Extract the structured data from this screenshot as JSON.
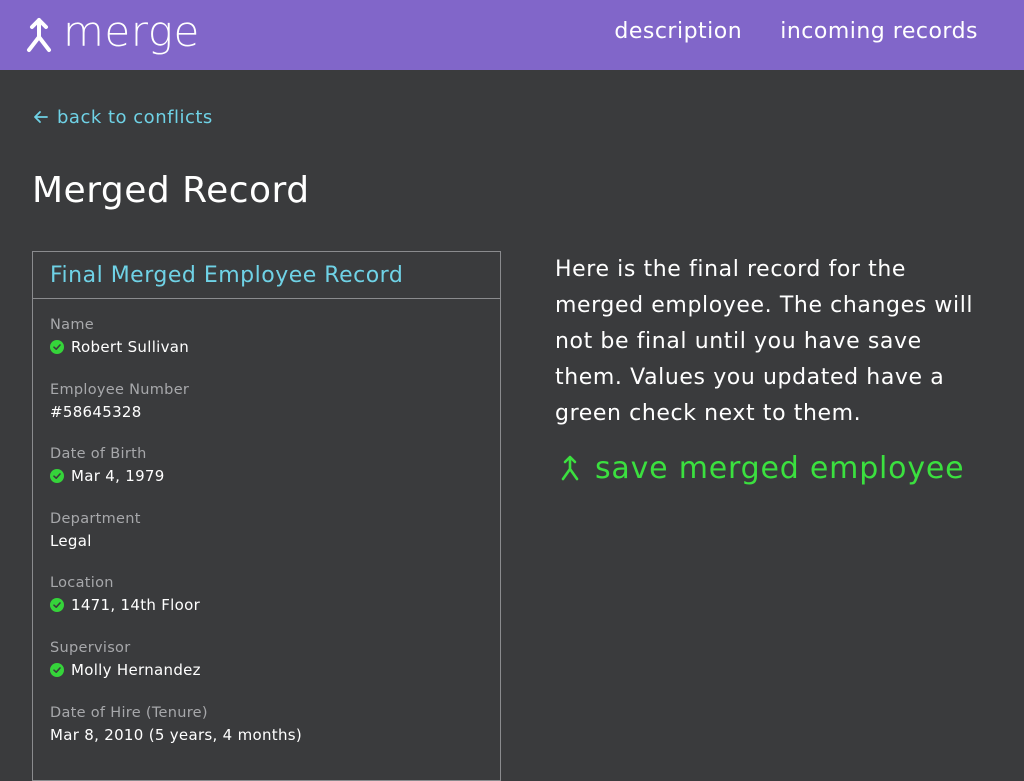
{
  "app": {
    "logo_text": "merge"
  },
  "nav": {
    "items": [
      {
        "label": "description"
      },
      {
        "label": "incoming records"
      }
    ]
  },
  "back_link": {
    "label": "back to conflicts"
  },
  "page_title": "Merged Record",
  "panel": {
    "title": "Final Merged Employee Record",
    "fields": [
      {
        "label": "Name",
        "value": "Robert Sullivan",
        "updated": true
      },
      {
        "label": "Employee Number",
        "value": "#58645328",
        "updated": false
      },
      {
        "label": "Date of Birth",
        "value": "Mar 4, 1979",
        "updated": true
      },
      {
        "label": "Department",
        "value": "Legal",
        "updated": false
      },
      {
        "label": "Location",
        "value": "1471, 14th Floor",
        "updated": true
      },
      {
        "label": "Supervisor",
        "value": "Molly Hernandez",
        "updated": true
      },
      {
        "label": "Date of Hire (Tenure)",
        "value": "Mar 8, 2010 (5 years, 4 months)",
        "updated": false
      }
    ]
  },
  "description": "Here is the final record for the merged employee. The changes will not be final until you have save them. Values you updated have a green check next to them.",
  "save_button": {
    "label": "save merged employee"
  },
  "colors": {
    "header_bg": "#8166c9",
    "page_bg": "#3a3b3d",
    "link": "#6fd2e6",
    "accent_green": "#3be03f",
    "check_green": "#35d43a"
  },
  "icons": {
    "logo": "merge-icon",
    "back": "arrow-left-icon",
    "check": "check-circle-icon",
    "save": "merge-icon"
  }
}
